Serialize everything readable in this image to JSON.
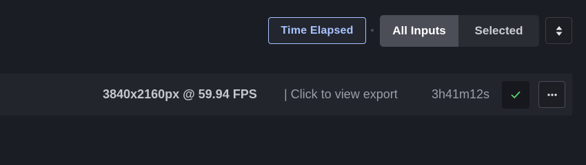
{
  "toolbar": {
    "time_elapsed_label": "Time Elapsed",
    "segment_all_label": "All Inputs",
    "segment_selected_label": "Selected",
    "active_segment": "All Inputs"
  },
  "export": {
    "resolution_label": "3840x2160px @ 59.94 FPS",
    "view_link_label": "| Click to view export",
    "duration": "3h41m12s",
    "status": "complete"
  },
  "icons": {
    "sort": "sort-arrows-icon",
    "status": "checkmark-icon",
    "more": "more-dots-icon"
  },
  "colors": {
    "background": "#1b1d24",
    "row_background": "#23252c",
    "accent_blue": "#a8c4ff",
    "success_green": "#5bd56f",
    "segment_active": "#4b4e56"
  }
}
